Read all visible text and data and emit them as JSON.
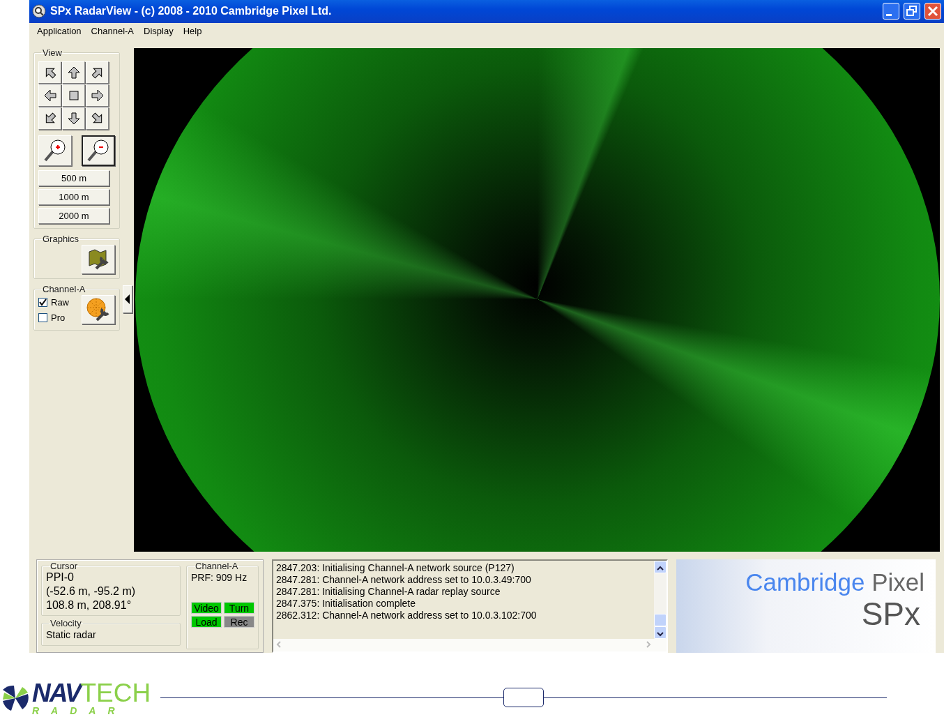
{
  "window": {
    "title": "SPx RadarView - (c) 2008 - 2010 Cambridge Pixel Ltd."
  },
  "menu": [
    "Application",
    "Channel-A",
    "Display",
    "Help"
  ],
  "view": {
    "label": "View",
    "ranges": [
      "500 m",
      "1000 m",
      "2000 m"
    ]
  },
  "graphics": {
    "label": "Graphics"
  },
  "channel": {
    "label": "Channel-A",
    "options": [
      {
        "label": "Raw",
        "checked": true
      },
      {
        "label": "Pro",
        "checked": false
      }
    ]
  },
  "cursor": {
    "label": "Cursor",
    "lines": [
      "PPI-0",
      "(-52.6 m, -95.2 m)",
      "108.8 m, 208.91°"
    ]
  },
  "velocity": {
    "label": "Velocity",
    "value": "Static radar"
  },
  "channel_status": {
    "label": "Channel-A",
    "prf": "PRF: 909 Hz",
    "indicators": [
      {
        "label": "Video",
        "on": true
      },
      {
        "label": "Turn",
        "on": true
      },
      {
        "label": "Load",
        "on": true
      },
      {
        "label": "Rec",
        "on": false
      }
    ]
  },
  "log": [
    "2847.203: Initialising Channel-A network source (P127)",
    "2847.281: Channel-A network address set to 10.0.3.49:700",
    "2847.281: Initialising Channel-A radar replay source",
    "2847.375: Initialisation complete",
    "2862.312: Channel-A network address set to 10.0.3.102:700"
  ],
  "brand": {
    "name_1": "Cambridge",
    "name_2": "Pixel",
    "product": "SPx"
  },
  "footer": {
    "logo_1": "NAV",
    "logo_2": "TECH",
    "logo_3": "RADAR"
  }
}
